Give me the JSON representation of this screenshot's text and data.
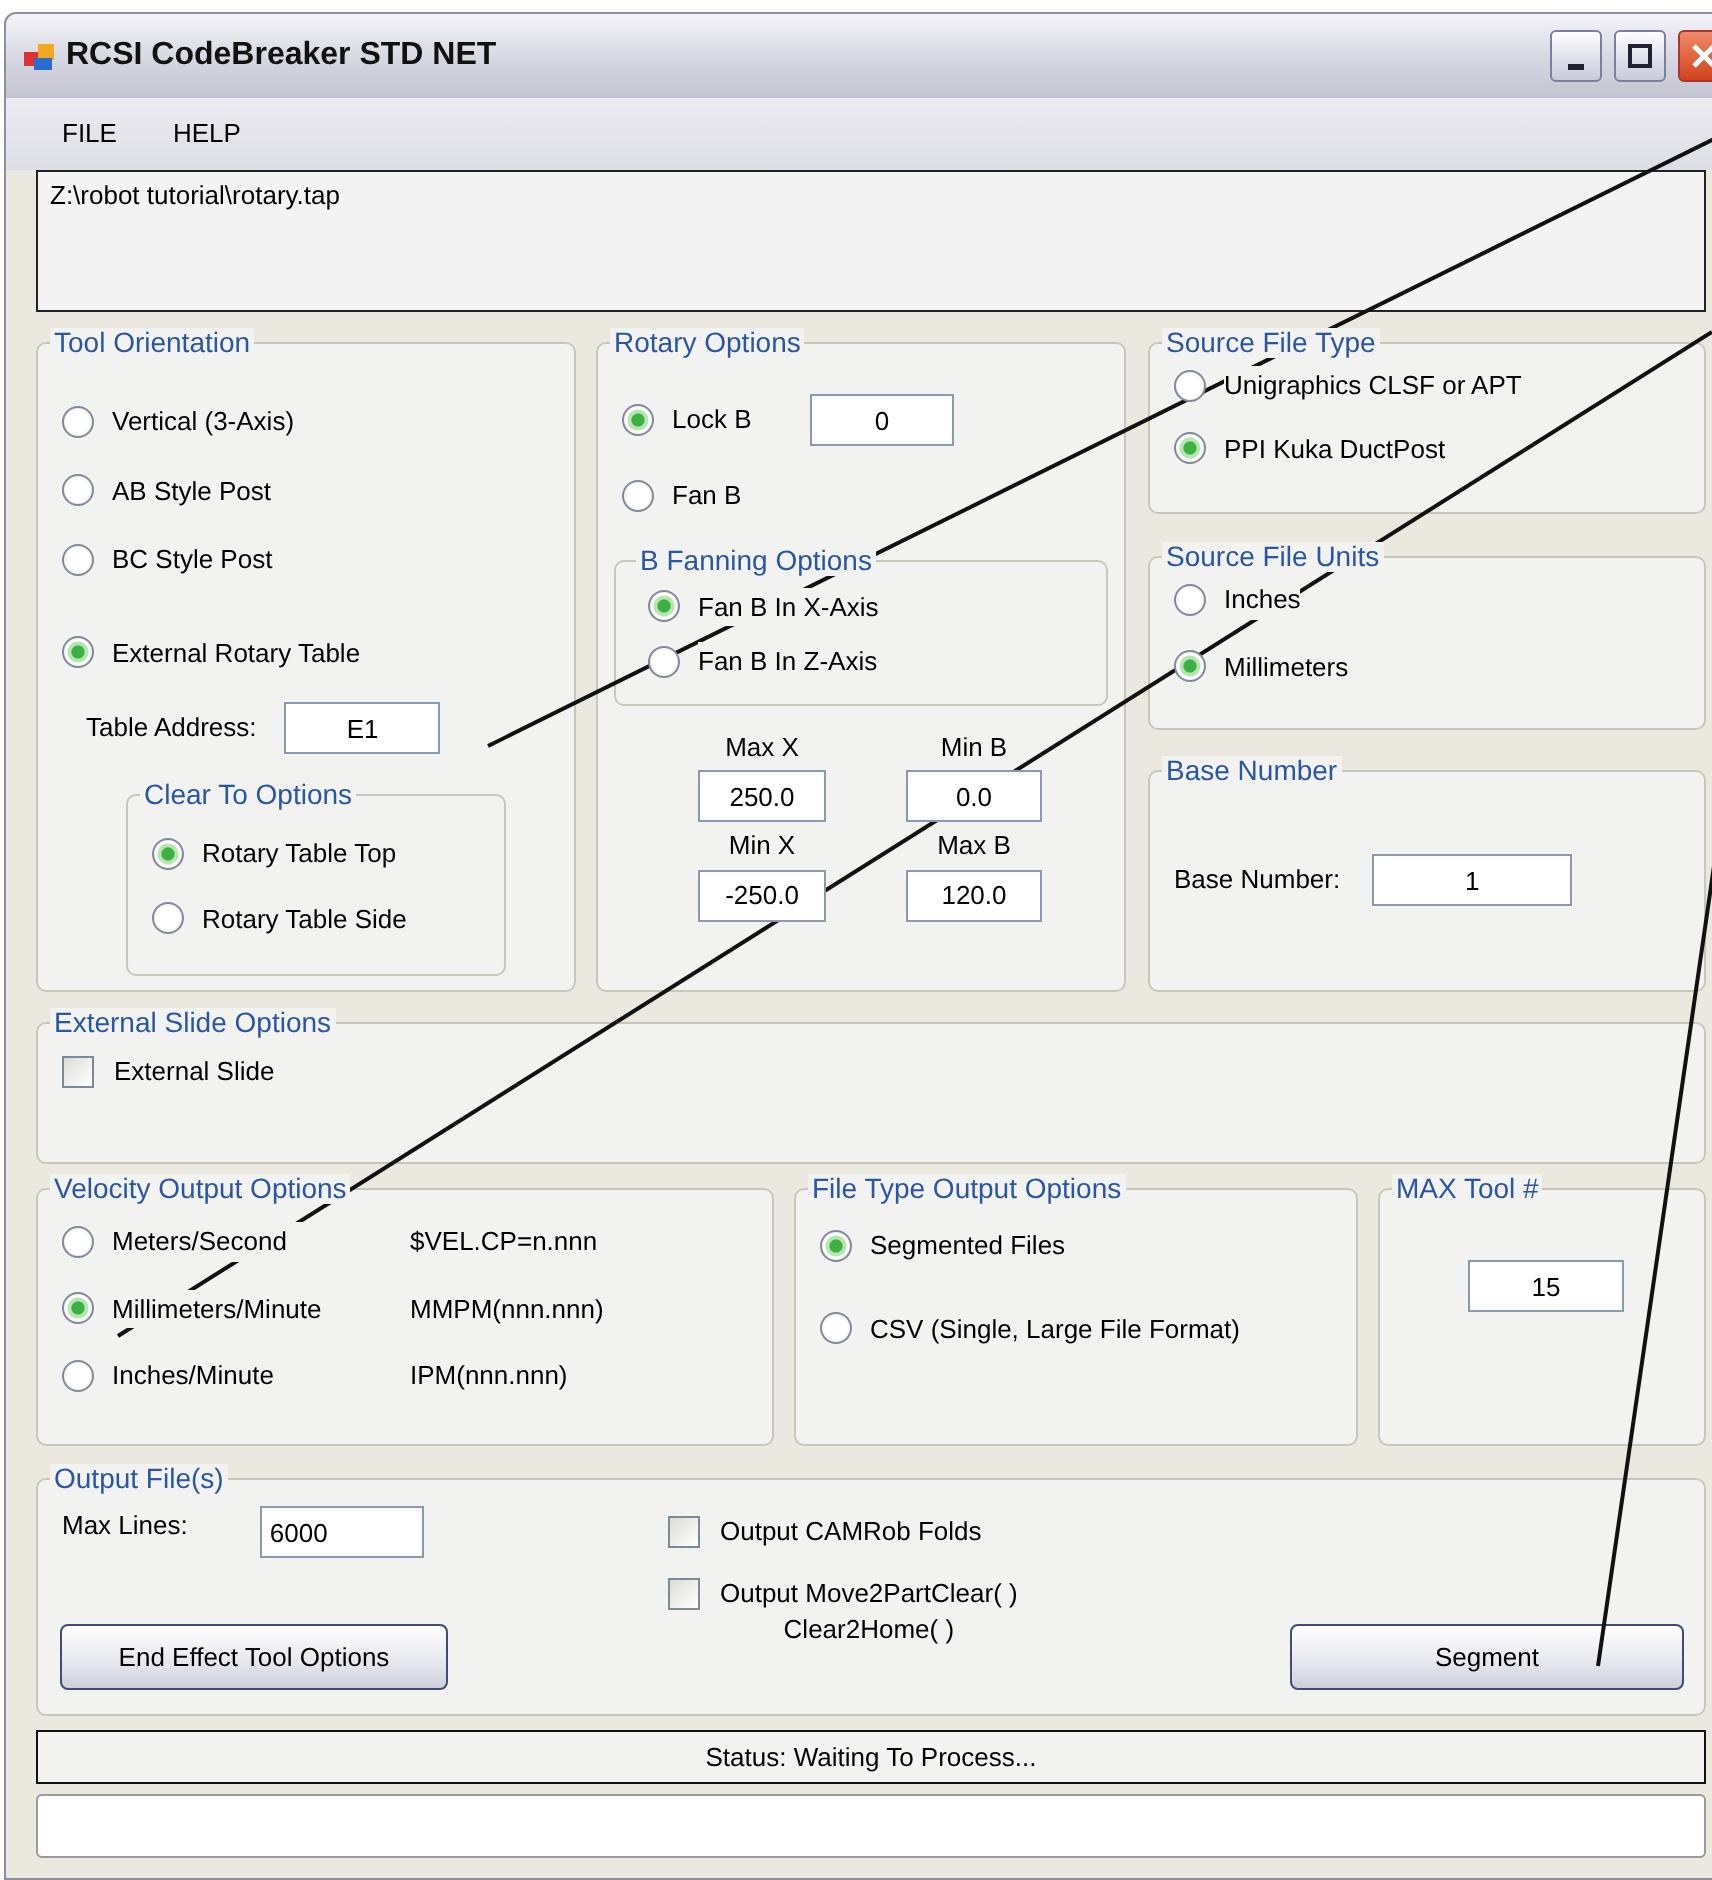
{
  "window": {
    "title": "RCSI CodeBreaker STD NET"
  },
  "menu": [
    "FILE",
    "HELP"
  ],
  "file_path": "Z:\\robot tutorial\\rotary.tap",
  "tool_orientation": {
    "title": "Tool Orientation",
    "options": [
      {
        "label": "Vertical (3-Axis)",
        "selected": false
      },
      {
        "label": "AB Style Post",
        "selected": false
      },
      {
        "label": "BC Style Post",
        "selected": false
      },
      {
        "label": "External Rotary Table",
        "selected": true
      }
    ],
    "table_address": {
      "label": "Table Address:",
      "value": "E1"
    },
    "clear_to": {
      "title": "Clear To Options",
      "options": [
        {
          "label": "Rotary Table Top",
          "selected": true
        },
        {
          "label": "Rotary Table Side",
          "selected": false
        }
      ]
    }
  },
  "rotary_options": {
    "title": "Rotary Options",
    "options": [
      {
        "label": "Lock B",
        "selected": true
      },
      {
        "label": "Fan B",
        "selected": false
      }
    ],
    "lock_b_value": "0",
    "fanning": {
      "title": "B Fanning Options",
      "options": [
        {
          "label": "Fan B In X-Axis",
          "selected": true
        },
        {
          "label": "Fan B In Z-Axis",
          "selected": false
        }
      ]
    },
    "limits": [
      {
        "label": "Max X",
        "value": "250.0"
      },
      {
        "label": "Min B",
        "value": "0.0"
      },
      {
        "label": "Min X",
        "value": "-250.0"
      },
      {
        "label": "Max B",
        "value": "120.0"
      }
    ]
  },
  "source_file_type": {
    "title": "Source File Type",
    "options": [
      {
        "label": "Unigraphics CLSF or APT",
        "selected": false
      },
      {
        "label": "PPI Kuka DuctPost",
        "selected": true
      }
    ]
  },
  "source_file_units": {
    "title": "Source File Units",
    "options": [
      {
        "label": "Inches",
        "selected": false
      },
      {
        "label": "Millimeters",
        "selected": true
      }
    ]
  },
  "base_number": {
    "title": "Base Number",
    "label": "Base Number:",
    "value": "1"
  },
  "external_slide": {
    "title": "External Slide Options",
    "label": "External Slide",
    "checked": false
  },
  "velocity_output": {
    "title": "Velocity Output Options",
    "options": [
      {
        "label": "Meters/Second",
        "format": "$VEL.CP=n.nnn",
        "selected": false
      },
      {
        "label": "Millimeters/Minute",
        "format": "MMPM(nnn.nnn)",
        "selected": true
      },
      {
        "label": "Inches/Minute",
        "format": "IPM(nnn.nnn)",
        "selected": false
      }
    ]
  },
  "file_type_output": {
    "title": "File Type Output Options",
    "options": [
      {
        "label": "Segmented Files",
        "selected": true
      },
      {
        "label": "CSV (Single, Large File Format)",
        "selected": false
      }
    ]
  },
  "max_tool": {
    "title": "MAX Tool #",
    "value": "15"
  },
  "output_files": {
    "title": "Output File(s)",
    "max_lines_label": "Max Lines:",
    "max_lines": "6000",
    "checkboxes": [
      {
        "label": "Output CAMRob Folds",
        "checked": false
      },
      {
        "label": "Output Move2PartClear( )\nClear2Home( )",
        "checked": false
      }
    ],
    "buttons": [
      "End Effect Tool Options",
      "Segment"
    ]
  },
  "status": "Status: Waiting To Process..."
}
